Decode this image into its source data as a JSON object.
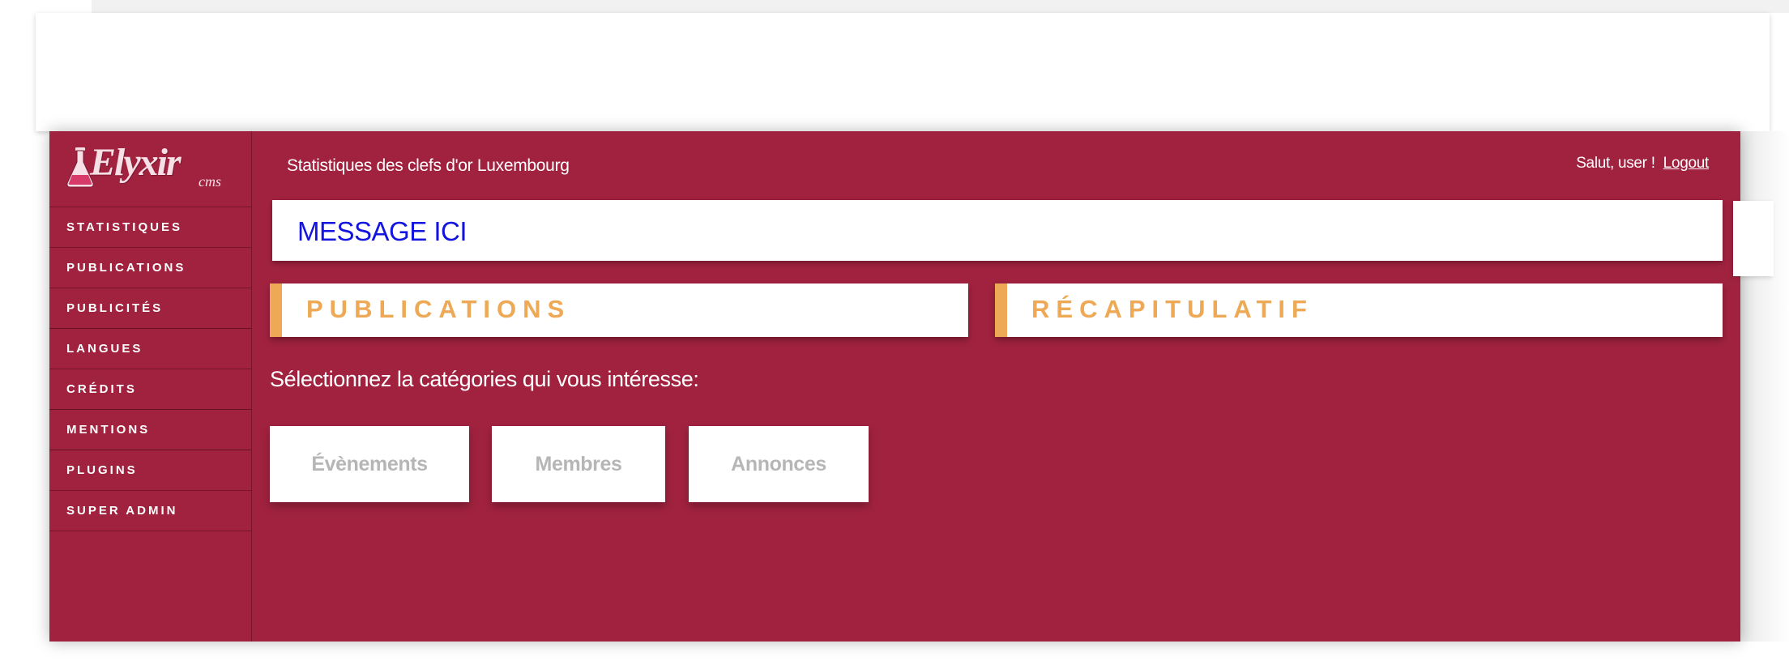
{
  "app": {
    "logo_text": "Elyxir",
    "logo_sub": "cms",
    "page_title": "Statistiques des clefs d'or Luxembourg",
    "greeting": "Salut, user !",
    "logout": "Logout",
    "message": "MESSAGE ICI"
  },
  "sidebar": {
    "items": [
      {
        "label": "STATISTIQUES"
      },
      {
        "label": "PUBLICATIONS"
      },
      {
        "label": "PUBLICITÉS"
      },
      {
        "label": "LANGUES"
      },
      {
        "label": "CRÉDITS"
      },
      {
        "label": "MENTIONS"
      },
      {
        "label": "PLUGINS"
      },
      {
        "label": "SUPER ADMIN"
      }
    ]
  },
  "panels": {
    "publications": "PUBLICATIONS",
    "recap": "RÉCAPITULATIF"
  },
  "categories": {
    "prompt": "Sélectionnez la catégories qui vous intéresse:",
    "items": [
      {
        "label": "Évènements"
      },
      {
        "label": "Membres"
      },
      {
        "label": "Annonces"
      }
    ]
  },
  "colors": {
    "primary": "#a1223f",
    "accent": "#eda956",
    "message_text": "#1414e0",
    "button_text": "#b6b6b6"
  },
  "icons": {
    "logo": "flask-icon"
  }
}
